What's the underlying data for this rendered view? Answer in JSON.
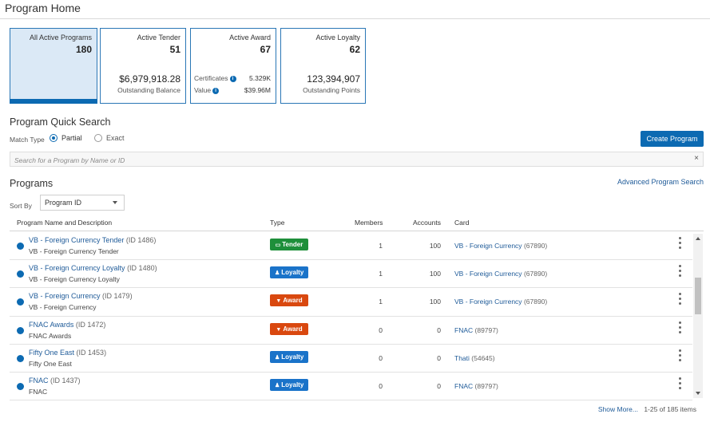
{
  "page": {
    "title": "Program Home"
  },
  "tiles": {
    "all": {
      "label": "All Active Programs",
      "count": "180"
    },
    "tender": {
      "label": "Active Tender",
      "count": "51",
      "amount": "$6,979,918.28",
      "amount_label": "Outstanding Balance"
    },
    "award": {
      "label": "Active Award",
      "count": "67",
      "cert_label": "Certificates",
      "cert_value": "5.329K",
      "value_label": "Value",
      "value_value": "$39.96M"
    },
    "loyalty": {
      "label": "Active Loyalty",
      "count": "62",
      "points": "123,394,907",
      "points_label": "Outstanding Points"
    }
  },
  "quick_search": {
    "title": "Program Quick Search",
    "match_type_label": "Match Type",
    "partial_label": "Partial",
    "exact_label": "Exact",
    "selected": "Partial",
    "placeholder": "Search for a Program by Name or ID",
    "clear_symbol": "×",
    "create_button": "Create Program"
  },
  "programs": {
    "title": "Programs",
    "advanced_search": "Advanced Program Search",
    "sort_label": "Sort By",
    "sort_value": "Program ID",
    "columns": {
      "name": "Program Name and Description",
      "type": "Type",
      "members": "Members",
      "accounts": "Accounts",
      "card": "Card"
    },
    "rows": [
      {
        "name": "VB - Foreign Currency Tender",
        "id": "(ID 1486)",
        "desc": "VB - Foreign Currency Tender",
        "type": "Tender",
        "members": "1",
        "accounts": "100",
        "card": "VB - Foreign Currency",
        "card_id": "(67890)"
      },
      {
        "name": "VB - Foreign Currency Loyalty",
        "id": "(ID 1480)",
        "desc": "VB - Foreign Currency Loyalty",
        "type": "Loyalty",
        "members": "1",
        "accounts": "100",
        "card": "VB - Foreign Currency",
        "card_id": "(67890)"
      },
      {
        "name": "VB - Foreign Currency",
        "id": "(ID 1479)",
        "desc": "VB - Foreign Currency",
        "type": "Award",
        "members": "1",
        "accounts": "100",
        "card": "VB - Foreign Currency",
        "card_id": "(67890)"
      },
      {
        "name": "FNAC Awards",
        "id": "(ID 1472)",
        "desc": "FNAC Awards",
        "type": "Award",
        "members": "0",
        "accounts": "0",
        "card": "FNAC",
        "card_id": "(89797)"
      },
      {
        "name": "Fifty One East",
        "id": "(ID 1453)",
        "desc": "Fifty One East",
        "type": "Loyalty",
        "members": "0",
        "accounts": "0",
        "card": "Thati",
        "card_id": "(54645)"
      },
      {
        "name": "FNAC",
        "id": "(ID 1437)",
        "desc": "FNAC",
        "type": "Loyalty",
        "members": "0",
        "accounts": "0",
        "card": "FNAC",
        "card_id": "(89797)"
      }
    ],
    "type_styles": {
      "Tender": {
        "color": "#1e8f3a",
        "icon": "▭"
      },
      "Loyalty": {
        "color": "#1a73c9",
        "icon": "♟"
      },
      "Award": {
        "color": "#d9480f",
        "icon": "▼"
      }
    },
    "footer_more": "Show More...",
    "footer_range": "1-25 of 185 items"
  }
}
